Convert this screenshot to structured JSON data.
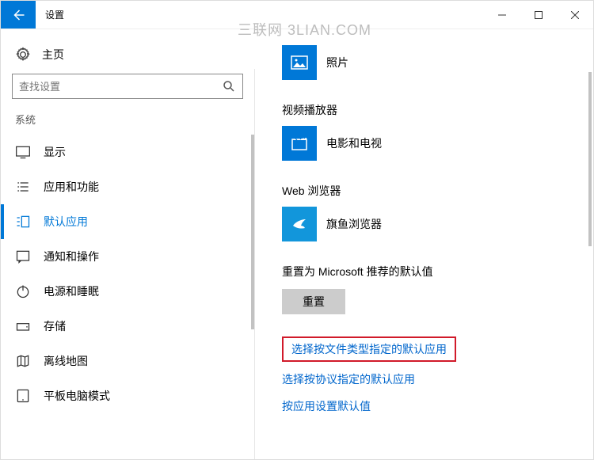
{
  "titlebar": {
    "title": "设置"
  },
  "watermark": "三联网 3LIAN.COM",
  "sidebar": {
    "home_label": "主页",
    "search_placeholder": "查找设置",
    "section_label": "系统",
    "items": [
      {
        "label": "显示"
      },
      {
        "label": "应用和功能"
      },
      {
        "label": "默认应用"
      },
      {
        "label": "通知和操作"
      },
      {
        "label": "电源和睡眠"
      },
      {
        "label": "存储"
      },
      {
        "label": "离线地图"
      },
      {
        "label": "平板电脑模式"
      }
    ]
  },
  "content": {
    "groups": [
      {
        "title": null,
        "app_name": "照片",
        "tile_icon": "photos"
      },
      {
        "title": "视频播放器",
        "app_name": "电影和电视",
        "tile_icon": "movies"
      },
      {
        "title": "Web 浏览器",
        "app_name": "旗鱼浏览器",
        "tile_icon": "swordfish"
      }
    ],
    "reset_heading": "重置为 Microsoft 推荐的默认值",
    "reset_button": "重置",
    "links": [
      {
        "label": "选择按文件类型指定的默认应用",
        "highlighted": true
      },
      {
        "label": "选择按协议指定的默认应用",
        "highlighted": false
      },
      {
        "label": "按应用设置默认值",
        "highlighted": false
      }
    ]
  }
}
